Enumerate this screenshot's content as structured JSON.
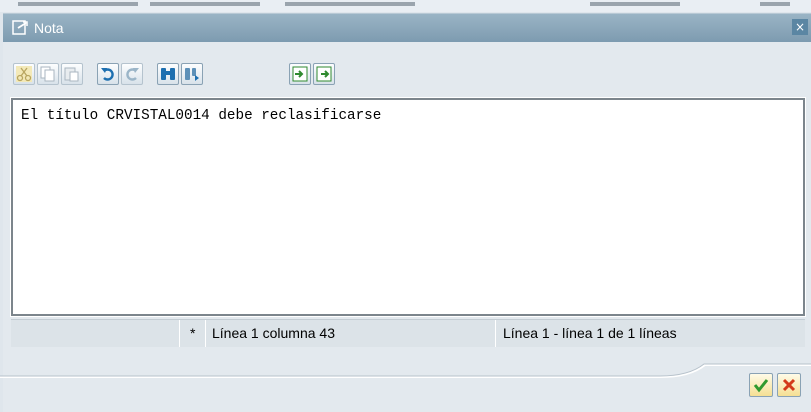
{
  "window": {
    "title": "Nota",
    "close_label": "×"
  },
  "toolbar": {
    "buttons": [
      {
        "icon": "cut-icon",
        "enabled": false
      },
      {
        "icon": "copy-icon",
        "enabled": false
      },
      {
        "icon": "paste-icon",
        "enabled": false
      },
      {
        "icon": "undo-icon",
        "enabled": true
      },
      {
        "icon": "redo-icon",
        "enabled": false
      },
      {
        "icon": "find-icon",
        "enabled": true
      },
      {
        "icon": "find-next-icon",
        "enabled": true
      },
      {
        "icon": "import-icon",
        "enabled": true
      },
      {
        "icon": "export-icon",
        "enabled": true
      }
    ]
  },
  "editor": {
    "text": "El título CRVISTAL0014 debe reclasificarse"
  },
  "status": {
    "modified_marker": "*",
    "cursor_position": "Línea 1 columna 43",
    "line_range": "Línea 1 - línea 1 de 1 líneas"
  },
  "footer": {
    "confirm_icon": "checkmark-icon",
    "cancel_icon": "cancel-x-icon"
  },
  "colors": {
    "titlebar": "#8aa7ba",
    "confirm": "#2f9a2f",
    "cancel": "#d33a1a",
    "toolbar_icon": "#1d6fb0"
  }
}
